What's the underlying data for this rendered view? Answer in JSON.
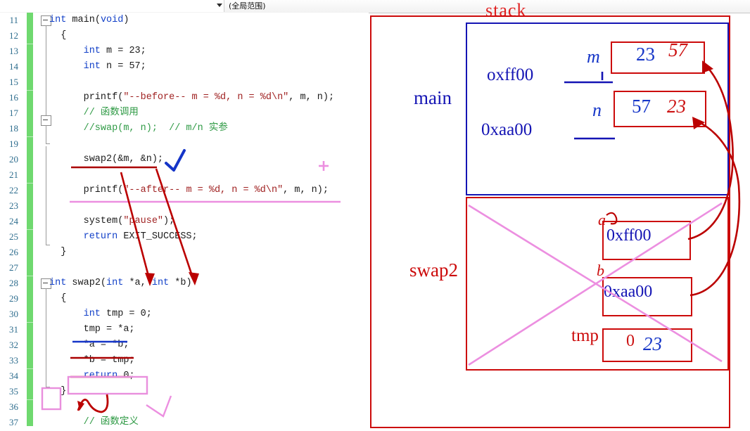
{
  "toolbar": {
    "scope_label": "(全局范围)",
    "chevron_icon": "chevron-down-icon"
  },
  "editor": {
    "line_numbers": [
      "11",
      "12",
      "13",
      "14",
      "15",
      "16",
      "17",
      "18",
      "19",
      "20",
      "21",
      "22",
      "23",
      "24",
      "25",
      "26",
      "27",
      "28",
      "29",
      "30",
      "31",
      "32",
      "33",
      "34",
      "35",
      "36",
      "37"
    ],
    "lines": [
      {
        "n": "11",
        "tokens": [
          {
            "t": "int",
            "c": "kw"
          },
          {
            "t": " main",
            "c": "id"
          },
          {
            "t": "(",
            "c": "id"
          },
          {
            "t": "void",
            "c": "kw"
          },
          {
            "t": ")",
            "c": "id"
          }
        ]
      },
      {
        "n": "12",
        "tokens": [
          {
            "t": "  {",
            "c": "id"
          }
        ]
      },
      {
        "n": "13",
        "tokens": [
          {
            "t": "      ",
            "c": "id"
          },
          {
            "t": "int",
            "c": "kw"
          },
          {
            "t": " m = ",
            "c": "id"
          },
          {
            "t": "23",
            "c": "cn"
          },
          {
            "t": ";",
            "c": "id"
          }
        ]
      },
      {
        "n": "14",
        "tokens": [
          {
            "t": "      ",
            "c": "id"
          },
          {
            "t": "int",
            "c": "kw"
          },
          {
            "t": " n = ",
            "c": "id"
          },
          {
            "t": "57",
            "c": "cn"
          },
          {
            "t": ";",
            "c": "id"
          }
        ]
      },
      {
        "n": "15",
        "tokens": [
          {
            "t": "",
            "c": "id"
          }
        ]
      },
      {
        "n": "16",
        "tokens": [
          {
            "t": "      printf(",
            "c": "id"
          },
          {
            "t": "\"--before-- m = %d, n = %d\\n\"",
            "c": "str"
          },
          {
            "t": ", m, n);",
            "c": "id"
          }
        ]
      },
      {
        "n": "17",
        "tokens": [
          {
            "t": "      ",
            "c": "id"
          },
          {
            "t": "// 函数调用",
            "c": "cmt"
          }
        ]
      },
      {
        "n": "18",
        "tokens": [
          {
            "t": "      ",
            "c": "id"
          },
          {
            "t": "//swap(m, n);  // m/n 实参",
            "c": "cmt"
          }
        ]
      },
      {
        "n": "19",
        "tokens": [
          {
            "t": "",
            "c": "id"
          }
        ]
      },
      {
        "n": "20",
        "tokens": [
          {
            "t": "      swap2(&m, &n);",
            "c": "id"
          }
        ]
      },
      {
        "n": "21",
        "tokens": [
          {
            "t": "",
            "c": "id"
          }
        ]
      },
      {
        "n": "22",
        "tokens": [
          {
            "t": "      printf(",
            "c": "id"
          },
          {
            "t": "\"--after-- m = %d, n = %d\\n\"",
            "c": "str"
          },
          {
            "t": ", m, n);",
            "c": "id"
          }
        ]
      },
      {
        "n": "23",
        "tokens": [
          {
            "t": "",
            "c": "id"
          }
        ]
      },
      {
        "n": "24",
        "tokens": [
          {
            "t": "      system(",
            "c": "id"
          },
          {
            "t": "\"pause\"",
            "c": "str"
          },
          {
            "t": ");",
            "c": "id"
          }
        ]
      },
      {
        "n": "25",
        "tokens": [
          {
            "t": "      ",
            "c": "id"
          },
          {
            "t": "return",
            "c": "kw"
          },
          {
            "t": " EXIT_SUCCESS;",
            "c": "id"
          }
        ]
      },
      {
        "n": "26",
        "tokens": [
          {
            "t": "  }",
            "c": "id"
          }
        ]
      },
      {
        "n": "27",
        "tokens": [
          {
            "t": "",
            "c": "id"
          }
        ]
      },
      {
        "n": "28",
        "tokens": [
          {
            "t": "int",
            "c": "kw"
          },
          {
            "t": " swap2(",
            "c": "id"
          },
          {
            "t": "int",
            "c": "kw"
          },
          {
            "t": " *a, ",
            "c": "id"
          },
          {
            "t": "int",
            "c": "kw"
          },
          {
            "t": " *b)",
            "c": "id"
          }
        ]
      },
      {
        "n": "29",
        "tokens": [
          {
            "t": "  {",
            "c": "id"
          }
        ]
      },
      {
        "n": "30",
        "tokens": [
          {
            "t": "      ",
            "c": "id"
          },
          {
            "t": "int",
            "c": "kw"
          },
          {
            "t": " tmp = ",
            "c": "id"
          },
          {
            "t": "0",
            "c": "cn"
          },
          {
            "t": ";",
            "c": "id"
          }
        ]
      },
      {
        "n": "31",
        "tokens": [
          {
            "t": "      tmp = *a;",
            "c": "id"
          }
        ]
      },
      {
        "n": "32",
        "tokens": [
          {
            "t": "      *a = *b;",
            "c": "id"
          }
        ]
      },
      {
        "n": "33",
        "tokens": [
          {
            "t": "      *b = tmp;",
            "c": "id"
          }
        ]
      },
      {
        "n": "34",
        "tokens": [
          {
            "t": "      ",
            "c": "id"
          },
          {
            "t": "return",
            "c": "kw"
          },
          {
            "t": " ",
            "c": "id"
          },
          {
            "t": "0",
            "c": "cn"
          },
          {
            "t": ";",
            "c": "id"
          }
        ]
      },
      {
        "n": "35",
        "tokens": [
          {
            "t": "  }",
            "c": "id"
          }
        ]
      },
      {
        "n": "36",
        "tokens": [
          {
            "t": "",
            "c": "id"
          }
        ]
      },
      {
        "n": "37",
        "tokens": [
          {
            "t": "      ",
            "c": "id"
          },
          {
            "t": "// 函数定义",
            "c": "cmt"
          }
        ]
      }
    ]
  },
  "diagram": {
    "stack_title": "stack",
    "main_label": "main",
    "swap_label": "swap2",
    "tmp_label": "tmp",
    "main_addr_1": "oxff00",
    "main_addr_2": "0xaa00",
    "swap_addr_1": "0xff00",
    "swap_addr_2": "0xaa00",
    "var_m_hand": "m",
    "var_n_hand": "n",
    "var_a_hand": "a",
    "var_b_hand": "b",
    "cell_m_old": "23",
    "cell_m_new": "57",
    "cell_n_old": "57",
    "cell_n_new": "23",
    "cell_tmp_old": "0",
    "cell_tmp_new": "23"
  },
  "colors": {
    "annotation_red": "#cc0a0a",
    "annotation_blue": "#1414b4",
    "annotation_pink": "#ec8fe0",
    "keyword_blue": "#1341c8",
    "string_red": "#a02222",
    "comment_green": "#2f9a45",
    "changebar_green": "#6fd96f",
    "linenum_blue": "#2e6d8e"
  }
}
